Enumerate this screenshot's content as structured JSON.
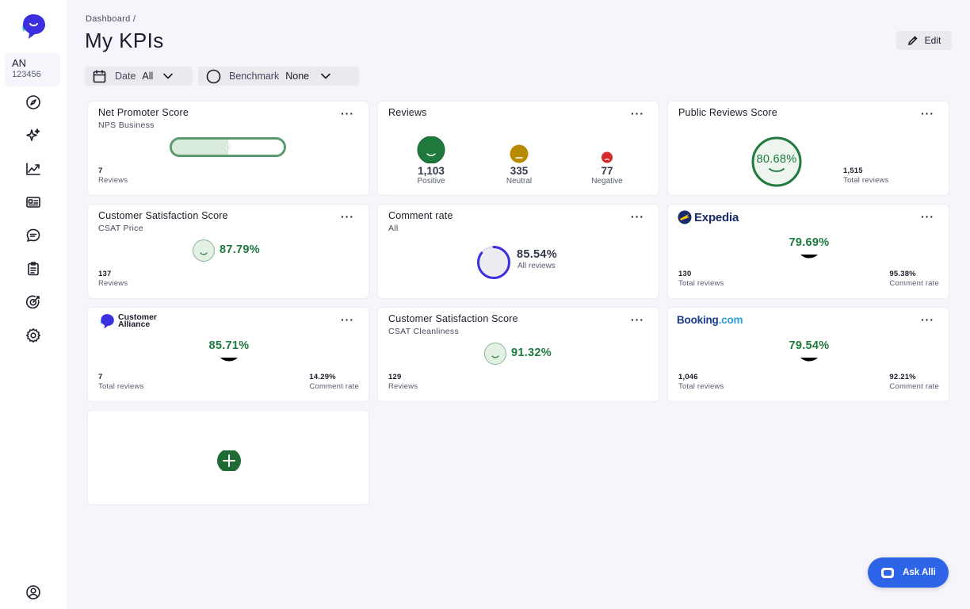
{
  "sidebar": {
    "account": {
      "initials": "AN",
      "id": "123456"
    },
    "nav_icons": [
      "compass-icon",
      "sparkle-icon",
      "chart-line-icon",
      "id-card-icon",
      "chat-icon",
      "clipboard-icon",
      "target-icon",
      "gear-icon"
    ],
    "bottom_icon": "user-circle-icon"
  },
  "header": {
    "breadcrumb": "Dashboard  /",
    "title": "My KPIs",
    "edit_label": "Edit"
  },
  "filters": {
    "date": {
      "label": "Date",
      "value": "All"
    },
    "benchmark": {
      "label": "Benchmark",
      "value": "None"
    }
  },
  "colors": {
    "accent_green": "#1e7a3c",
    "brand_blue": "#2d64e8",
    "neutral": "#b88a00",
    "negative": "#d42a2a",
    "comment_ring": "#3b2fe0"
  },
  "cards": {
    "nps": {
      "title": "Net Promoter Score",
      "subtitle": "NPS Business",
      "value": "0",
      "bar_fill_fraction": 0.5,
      "count": "7",
      "count_label": "Reviews"
    },
    "reviews": {
      "title": "Reviews",
      "positive": {
        "count": "1,103",
        "label": "Positive"
      },
      "neutral": {
        "count": "335",
        "label": "Neutral"
      },
      "negative": {
        "count": "77",
        "label": "Negative"
      }
    },
    "public_score": {
      "title": "Public Reviews Score",
      "value": "80.68%",
      "count": "1,515",
      "count_label": "Total reviews"
    },
    "csat_price": {
      "title": "Customer Satisfaction Score",
      "subtitle": "CSAT Price",
      "value": "87.79%",
      "count": "137",
      "count_label": "Reviews"
    },
    "comment_rate": {
      "title": "Comment rate",
      "subtitle": "All",
      "value": "85.54%",
      "value_label": "All reviews",
      "fraction": 0.8554
    },
    "expedia": {
      "brand": "Expedia",
      "value": "79.69%",
      "count": "130",
      "count_label": "Total reviews",
      "rate": "95.38%",
      "rate_label": "Comment rate"
    },
    "customer_alliance": {
      "brand_line1": "Customer",
      "brand_line2": "Alliance",
      "value": "85.71%",
      "count": "7",
      "count_label": "Total reviews",
      "rate": "14.29%",
      "rate_label": "Comment rate"
    },
    "csat_cleanliness": {
      "title": "Customer Satisfaction Score",
      "subtitle": "CSAT Cleanliness",
      "value": "91.32%",
      "count": "129",
      "count_label": "Reviews"
    },
    "booking": {
      "brand_main": "Booking",
      "brand_suffix": ".com",
      "value": "79.54%",
      "count": "1,046",
      "count_label": "Total reviews",
      "rate": "92.21%",
      "rate_label": "Comment rate"
    }
  },
  "ask_alli": {
    "label": "Ask Alli"
  }
}
